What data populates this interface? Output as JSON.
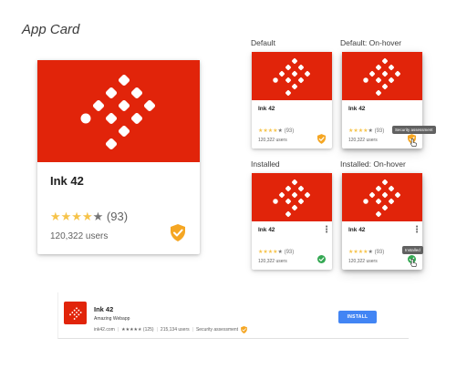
{
  "page": {
    "title": "App Card"
  },
  "colors": {
    "brand_red": "#e1240a",
    "star": "#f6c34a",
    "shield_orange": "#f5a623",
    "check_green": "#34a853",
    "install_blue": "#4285f4"
  },
  "variants": {
    "default": "Default",
    "default_hover": "Default: On-hover",
    "installed": "Installed",
    "installed_hover": "Installed: On-hover"
  },
  "app": {
    "name": "Ink 42",
    "rating_count": "(93)",
    "users": "120,322 users",
    "rating_stars": 4
  },
  "tooltips": {
    "security": "Security assessment",
    "installed": "Installed"
  },
  "listing": {
    "title": "Ink 42",
    "subtitle": "Amazing Webapp",
    "domain": "ink42.com",
    "rating_count": "(125)",
    "users": "215,134 users",
    "security_label": "Security assessment",
    "install_label": "INSTALL"
  },
  "icons": {
    "logo": "ink-diamonds-logo",
    "shield": "shield-check-icon",
    "installed": "check-circle-icon",
    "more": "more-vert-icon",
    "cursor": "pointer-cursor"
  }
}
